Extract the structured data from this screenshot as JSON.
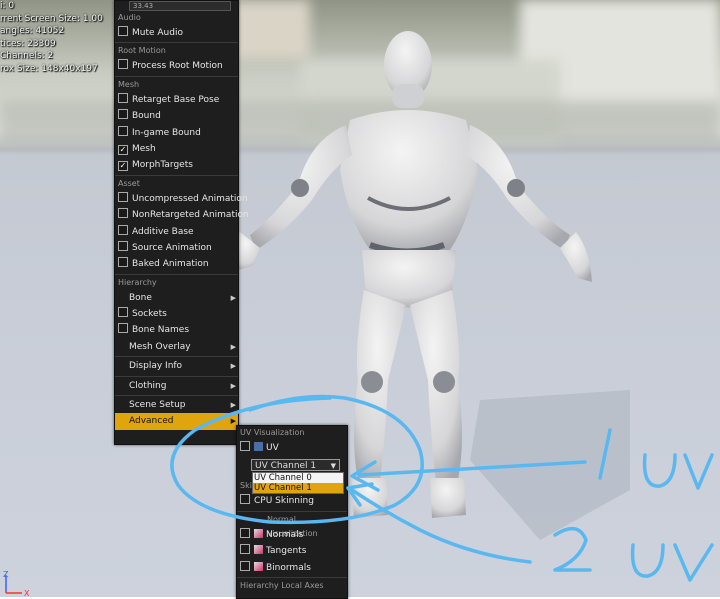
{
  "stats": {
    "lines": [
      "i: 0",
      "rrent Screen Size: 1.00",
      "angles: 41052",
      "tices: 23309",
      "Channels: 2",
      "rox Size: 148x40x197"
    ]
  },
  "menu": {
    "top_field": "33.43",
    "audio": {
      "header": "Audio",
      "mute": "Mute Audio"
    },
    "root_motion": {
      "header": "Root Motion",
      "process": "Process Root Motion"
    },
    "mesh": {
      "header": "Mesh",
      "items": [
        "Retarget Base Pose",
        "Bound",
        "In-game Bound",
        "Mesh",
        "MorphTargets"
      ],
      "checked": [
        false,
        false,
        false,
        true,
        true
      ]
    },
    "asset": {
      "header": "Asset",
      "items": [
        "Uncompressed Animation",
        "NonRetargeted Animation",
        "Additive Base",
        "Source Animation",
        "Baked Animation"
      ]
    },
    "hierarchy": {
      "header": "Hierarchy",
      "bone": "Bone",
      "sockets": "Sockets",
      "bone_names": "Bone Names",
      "mesh_overlay": "Mesh Overlay"
    },
    "display_info": "Display Info",
    "clothing": "Clothing",
    "scene_setup": "Scene Setup",
    "advanced": "Advanced"
  },
  "submenu": {
    "uv_header": "UV Visualization",
    "uv_label": "UV",
    "dropdown_value": "UV Channel 1",
    "dropdown_options": [
      "UV Channel 0",
      "UV Channel 1"
    ],
    "dropdown_selected": 1,
    "skin_header_fragment": "Skin",
    "cpu_skinning": "CPU Skinning",
    "normal_header": "Normal Visualization",
    "normals": "Normals",
    "tangents": "Tangents",
    "binormals": "Binormals",
    "hierarchy_axes": "Hierarchy Local Axes"
  },
  "annotations": {
    "first": "1 uv",
    "second": "2 uv",
    "color": "#5ab8f0"
  },
  "axes": {
    "z": "Z",
    "x": "X"
  },
  "colors": {
    "accent": "#e0a40e",
    "menu_bg": "#1e1e1e"
  }
}
